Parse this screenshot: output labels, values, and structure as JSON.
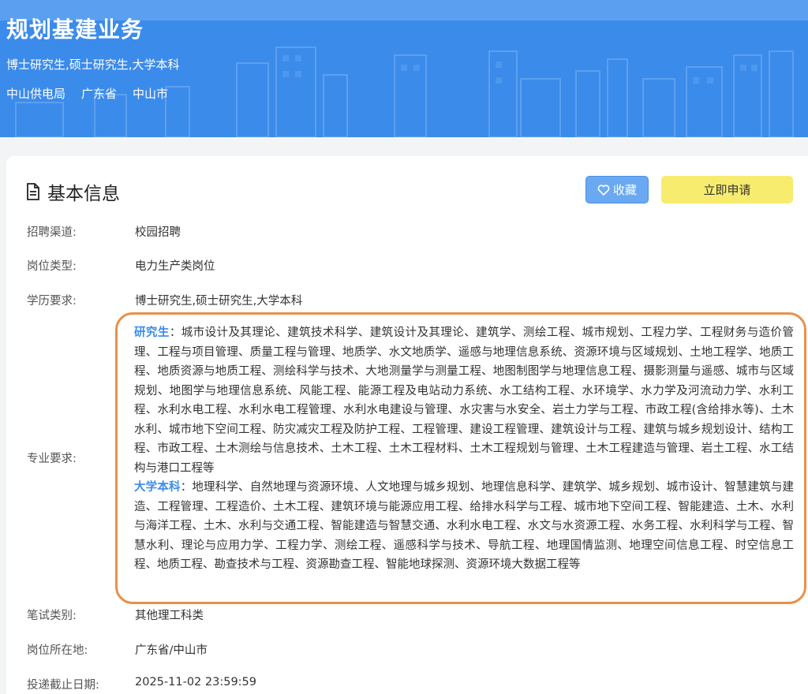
{
  "header": {
    "title": "规划基建业务",
    "education": "博士研究生,硕士研究生,大学本科",
    "company": "中山供电局",
    "province": "广东省",
    "city": "中山市"
  },
  "section": {
    "title": "基本信息",
    "favorite_label": "收藏",
    "apply_label": "立即申请"
  },
  "fields": {
    "channel": {
      "label": "招聘渠道:",
      "value": "校园招聘"
    },
    "job_type": {
      "label": "岗位类型:",
      "value": "电力生产类岗位"
    },
    "education": {
      "label": "学历要求:",
      "value": "博士研究生,硕士研究生,大学本科"
    },
    "major": {
      "label": "专业要求:",
      "grad_tag": "研究生",
      "grad_text": "：城市设计及其理论、建筑技术科学、建筑设计及其理论、建筑学、测绘工程、城市规划、工程力学、工程财务与造价管理、工程与项目管理、质量工程与管理、地质学、水文地质学、遥感与地理信息系统、资源环境与区域规划、土地工程学、地质工程、地质资源与地质工程、测绘科学与技术、大地测量学与测量工程、地图制图学与地理信息工程、摄影测量与遥感、城市与区域规划、地图学与地理信息系统、风能工程、能源工程及电站动力系统、水工结构工程、水环境学、水力学及河流动力学、水利工程、水利水电工程、水利水电工程管理、水利水电建设与管理、水灾害与水安全、岩土力学与工程、市政工程(含给排水等)、土木水利、城市地下空间工程、防灾减灾工程及防护工程、工程管理、建设工程管理、建筑设计与工程、建筑与城乡规划设计、结构工程、市政工程、土木测绘与信息技术、土木工程、土木工程材料、土木工程规划与管理、土木工程建造与管理、岩土工程、水工结构与港口工程等",
      "ug_tag": "大学本科",
      "ug_text": "：地理科学、自然地理与资源环境、人文地理与城乡规划、地理信息科学、建筑学、城乡规划、城市设计、智慧建筑与建造、工程管理、工程造价、土木工程、建筑环境与能源应用工程、给排水科学与工程、城市地下空间工程、智能建造、土木、水利与海洋工程、土木、水利与交通工程、智能建造与智慧交通、水利水电工程、水文与水资源工程、水务工程、水利科学与工程、智慧水利、理论与应用力学、工程力学、测绘工程、遥感科学与技术、导航工程、地理国情监测、地理空间信息工程、时空信息工程、地质工程、勘查技术与工程、资源勘查工程、智能地球探测、资源环境大数据工程等"
    },
    "exam": {
      "label": "笔试类别:",
      "value": "其他理工科类"
    },
    "location": {
      "label": "岗位所在地:",
      "value": "广东省/中山市"
    },
    "deadline": {
      "label": "投递截止日期:",
      "value": "2025-11-02 23:59:59"
    }
  },
  "colors": {
    "banner": "#3b8beb",
    "accent": "#3b8beb",
    "highlight_border": "#e8904b",
    "apply_button": "#f7ec6e"
  },
  "icons": {
    "section": "document-icon",
    "favorite": "heart-icon"
  }
}
